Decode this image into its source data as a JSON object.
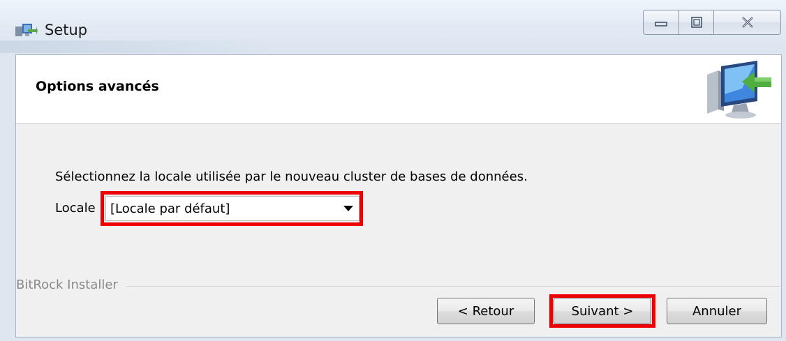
{
  "window": {
    "title": "Setup",
    "app_icon": "installer-app-icon",
    "controls": {
      "minimize_icon": "minimize-icon",
      "maximize_icon": "maximize-icon",
      "close_icon": "close-icon"
    }
  },
  "header": {
    "title": "Options avancés",
    "logo_icon": "computer-install-arrow-icon"
  },
  "content": {
    "instruction": "Sélectionnez la locale utilisée par le nouveau cluster de bases de données.",
    "locale_label": "Locale",
    "locale_value": "[Locale par défaut]",
    "dropdown_icon": "chevron-down-icon"
  },
  "footer": {
    "brand": "BitRock Installer",
    "back_label": "< Retour",
    "next_label": "Suivant >",
    "cancel_label": "Annuler"
  },
  "colors": {
    "highlight": "#ee0000",
    "window_frame": "#dfe6ef",
    "dialog_bg": "#f0f0f0",
    "header_bg": "#ffffff"
  }
}
